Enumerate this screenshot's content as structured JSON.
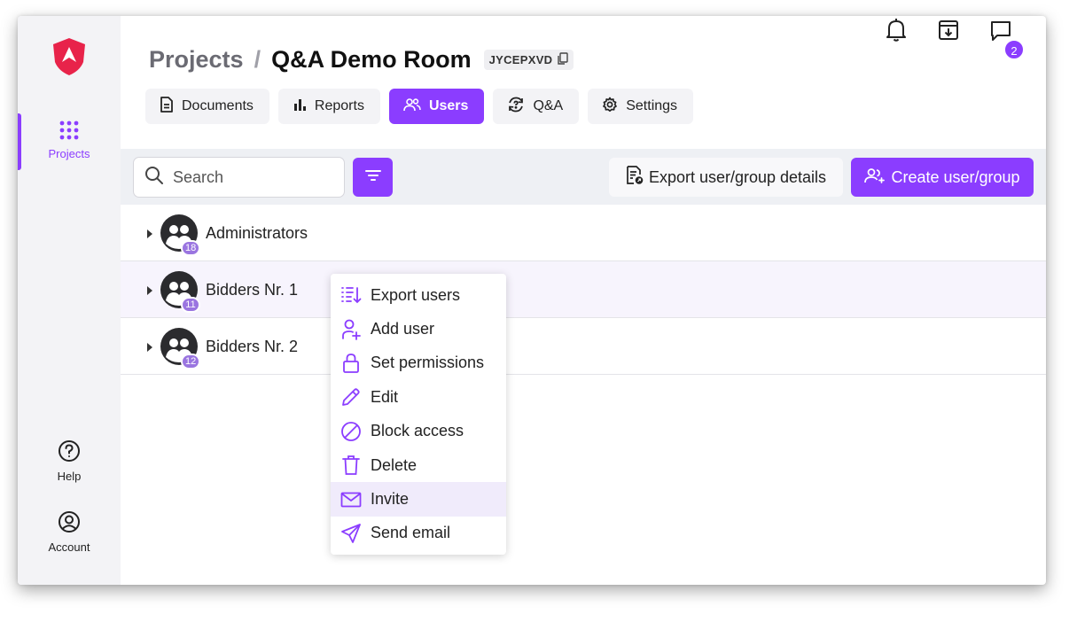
{
  "sidebar": {
    "items": [
      {
        "label": "Projects",
        "icon": "grid-dots-icon",
        "active": true
      },
      {
        "label": "Help",
        "icon": "question-circle-icon"
      },
      {
        "label": "Account",
        "icon": "user-circle-icon"
      }
    ],
    "logo_icon": "shield-logo-icon"
  },
  "header": {
    "breadcrumb_root": "Projects",
    "breadcrumb_separator": "/",
    "title": "Q&A Demo Room",
    "room_code": "JYCEPXVD",
    "notification_badge": "2"
  },
  "tabs": [
    {
      "label": "Documents",
      "icon": "document-icon"
    },
    {
      "label": "Reports",
      "icon": "bar-chart-icon"
    },
    {
      "label": "Users",
      "icon": "users-icon",
      "active": true
    },
    {
      "label": "Q&A",
      "icon": "sync-question-icon"
    },
    {
      "label": "Settings",
      "icon": "gear-icon"
    }
  ],
  "toolbar": {
    "search_placeholder": "Search",
    "export_label": "Export user/group details",
    "create_label": "Create user/group"
  },
  "groups": [
    {
      "name": "Administrators",
      "count": "18"
    },
    {
      "name": "Bidders Nr. 1",
      "count": "11"
    },
    {
      "name": "Bidders Nr. 2",
      "count": "12"
    }
  ],
  "context_menu": [
    {
      "label": "Export users",
      "icon": "export-list-icon"
    },
    {
      "label": "Add user",
      "icon": "add-user-icon"
    },
    {
      "label": "Set permissions",
      "icon": "lock-icon"
    },
    {
      "label": "Edit",
      "icon": "pencil-icon"
    },
    {
      "label": "Block access",
      "icon": "block-icon"
    },
    {
      "label": "Delete",
      "icon": "trash-icon"
    },
    {
      "label": "Invite",
      "icon": "envelope-icon"
    },
    {
      "label": "Send email",
      "icon": "send-icon"
    }
  ],
  "colors": {
    "accent": "#8b3dff",
    "logo": "#e8234a",
    "badge": "#9a75e0"
  }
}
